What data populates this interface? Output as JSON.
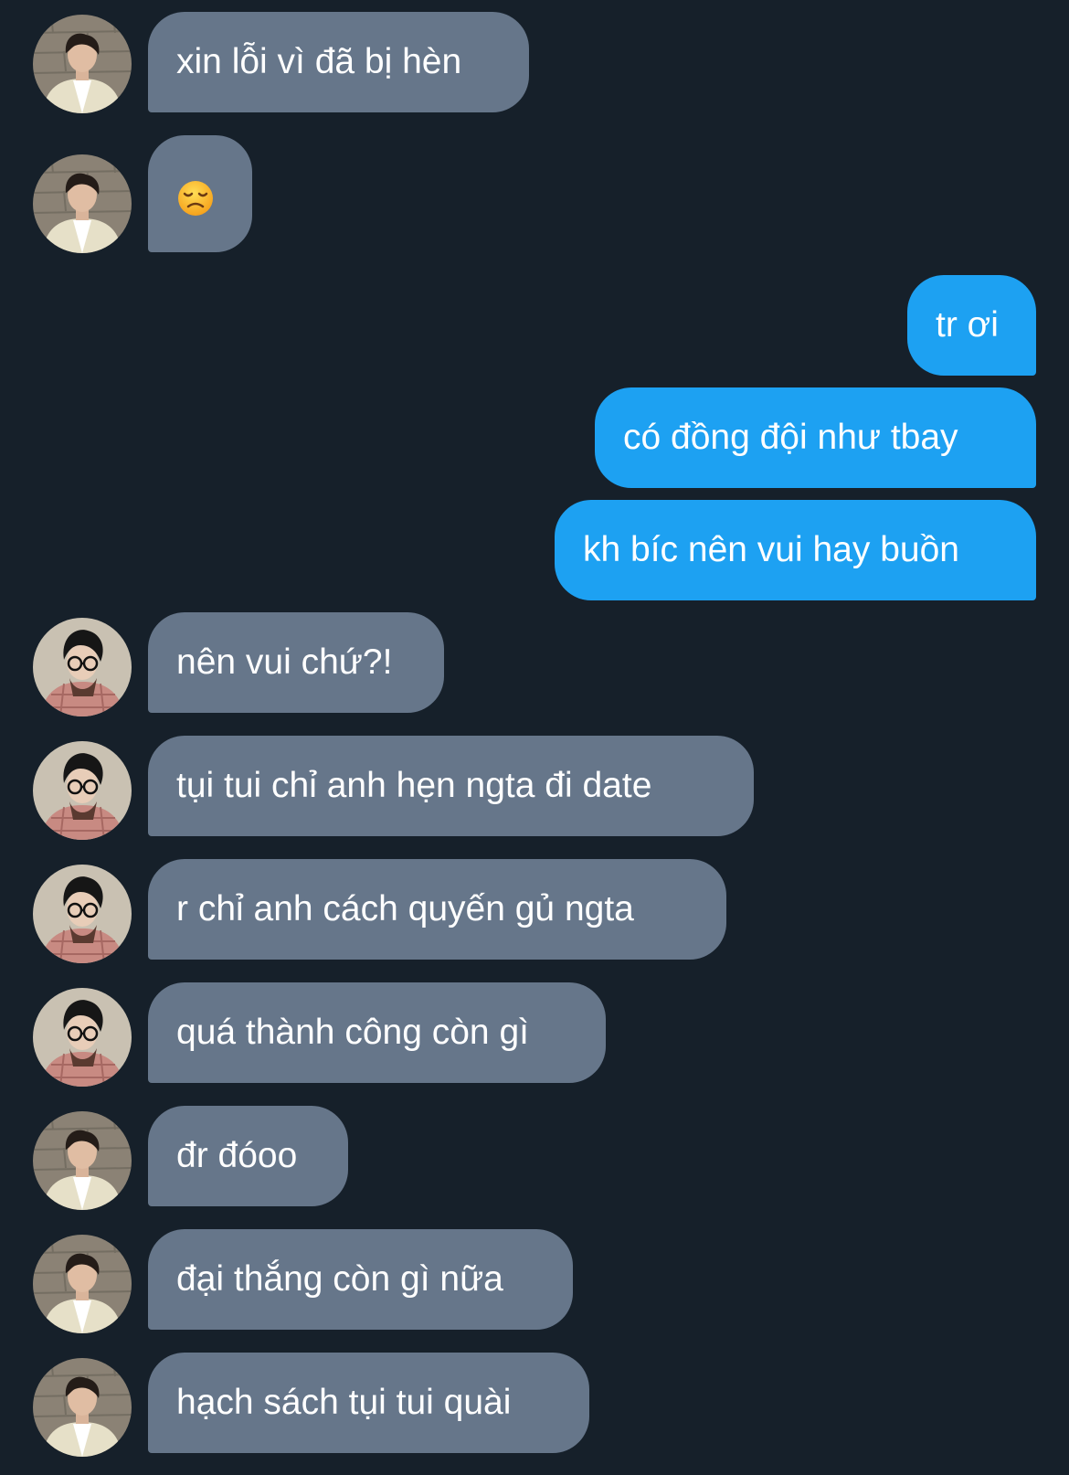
{
  "conversation": {
    "messages": [
      {
        "sender": "contact-a",
        "text": "xin lỗi vì đã bị hèn"
      },
      {
        "sender": "contact-a",
        "text": "",
        "emoji": "disappointed-face-icon"
      },
      {
        "sender": "me",
        "text": "tr ơi"
      },
      {
        "sender": "me",
        "text": "có đồng đội như tbay"
      },
      {
        "sender": "me",
        "text": "kh bíc nên vui hay buồn"
      },
      {
        "sender": "contact-b",
        "text": "nên vui chứ?!"
      },
      {
        "sender": "contact-b",
        "text": "tụi tui chỉ anh hẹn ngta đi date"
      },
      {
        "sender": "contact-b",
        "text": "r chỉ anh cách quyến gủ ngta"
      },
      {
        "sender": "contact-b",
        "text": "quá thành công còn gì"
      },
      {
        "sender": "contact-a",
        "text": "đr đóoo"
      },
      {
        "sender": "contact-a",
        "text": "đại thắng còn gì nữa"
      },
      {
        "sender": "contact-a",
        "text": "hạch sách tụi tui quài"
      }
    ]
  },
  "colors": {
    "background": "#16202a",
    "incoming_bubble": "#66768a",
    "outgoing_bubble": "#1da1f2",
    "text": "#ffffff"
  }
}
